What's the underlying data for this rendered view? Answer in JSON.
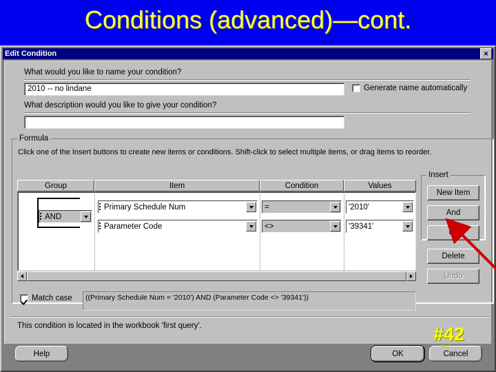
{
  "slide": {
    "title": "Conditions (advanced)—cont.",
    "number": "#42",
    "number_ghost": "42",
    "title_color": "#ffff4d",
    "background_color": "#0000f0"
  },
  "dialog": {
    "title": "Edit Condition",
    "close_icon": "close-icon",
    "name_prompt": "What would you like to name your condition?",
    "name_value": "2010 -- no lindane",
    "generate_name_label": "Generate name automatically",
    "generate_name_checked": false,
    "description_prompt": "What description would you like to give your condition?",
    "description_value": "",
    "formula_group_title": "Formula",
    "formula_hint": "Click one of the Insert buttons to create new items or conditions. Shift-click to select multiple items, or drag items to reorder.",
    "columns": [
      "Group",
      "Item",
      "Condition",
      "Values"
    ],
    "rows": [
      {
        "group": "AND",
        "item": "Primary Schedule Num",
        "condition": "=",
        "value": "'2010'"
      },
      {
        "group": "",
        "item": "Parameter Code",
        "condition": "<>",
        "value": "'39341'"
      }
    ],
    "match_case_label": "Match case",
    "match_case_checked": true,
    "formula_expression": "((Primary Schedule Num = '2010') AND (Parameter Code <> '39341'))",
    "status_text": "This condition is located in the workbook 'first query'.",
    "insert_group_title": "Insert",
    "buttons": {
      "new_item": "New Item",
      "and": "And",
      "or": "Or",
      "delete": "Delete",
      "undo": "Undo",
      "undo_disabled": true,
      "help": "Help",
      "ok": "OK",
      "cancel": "Cancel"
    }
  },
  "annotation": {
    "arrow_color": "#cc0000",
    "points_to": "new-item-button"
  }
}
